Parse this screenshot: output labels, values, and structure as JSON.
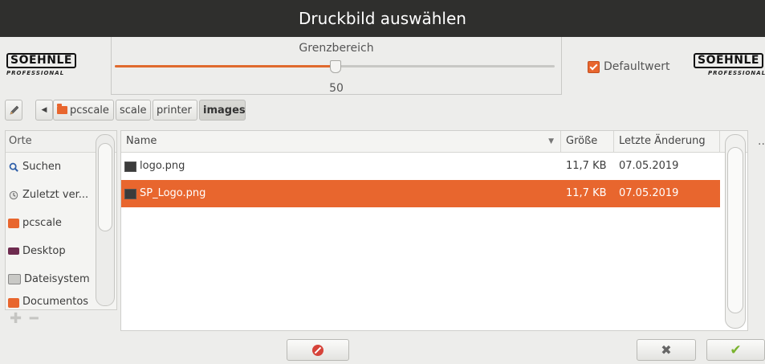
{
  "window": {
    "title": "Druckbild auswählen"
  },
  "logos": {
    "left_brand": "SOEHNLE",
    "left_sub": "PROFESSIONAL",
    "right_brand": "SOEHNLE",
    "right_sub": "PROFESSIONAL"
  },
  "slider": {
    "label": "Grenzbereich",
    "value": "50",
    "fraction": 0.5
  },
  "default_checkbox": {
    "label": "Defaultwert",
    "checked": true
  },
  "pathbar": {
    "segments": [
      "pcscale",
      "scale",
      "printer",
      "images"
    ],
    "active": "images"
  },
  "places": {
    "header": "Orte",
    "items": [
      {
        "label": "Suchen",
        "icon": "search-icon"
      },
      {
        "label": "Zuletzt ver...",
        "icon": "recent-icon"
      },
      {
        "label": "pcscale",
        "icon": "home-folder-icon"
      },
      {
        "label": "Desktop",
        "icon": "desktop-icon"
      },
      {
        "label": "Dateisystem",
        "icon": "drive-icon"
      },
      {
        "label": "Documentos",
        "icon": "folder-icon"
      }
    ]
  },
  "files": {
    "columns": {
      "name": "Name",
      "size": "Größe",
      "modified": "Letzte Änderung"
    },
    "rows": [
      {
        "name": "logo.png",
        "size": "11,7 KB",
        "modified": "07.05.2019",
        "selected": false
      },
      {
        "name": "SP_Logo.png",
        "size": "11,7 KB",
        "modified": "07.05.2019",
        "selected": true
      }
    ]
  },
  "more_menu": "...",
  "colors": {
    "accent": "#e8662e",
    "titlebar": "#2f2f2d"
  }
}
